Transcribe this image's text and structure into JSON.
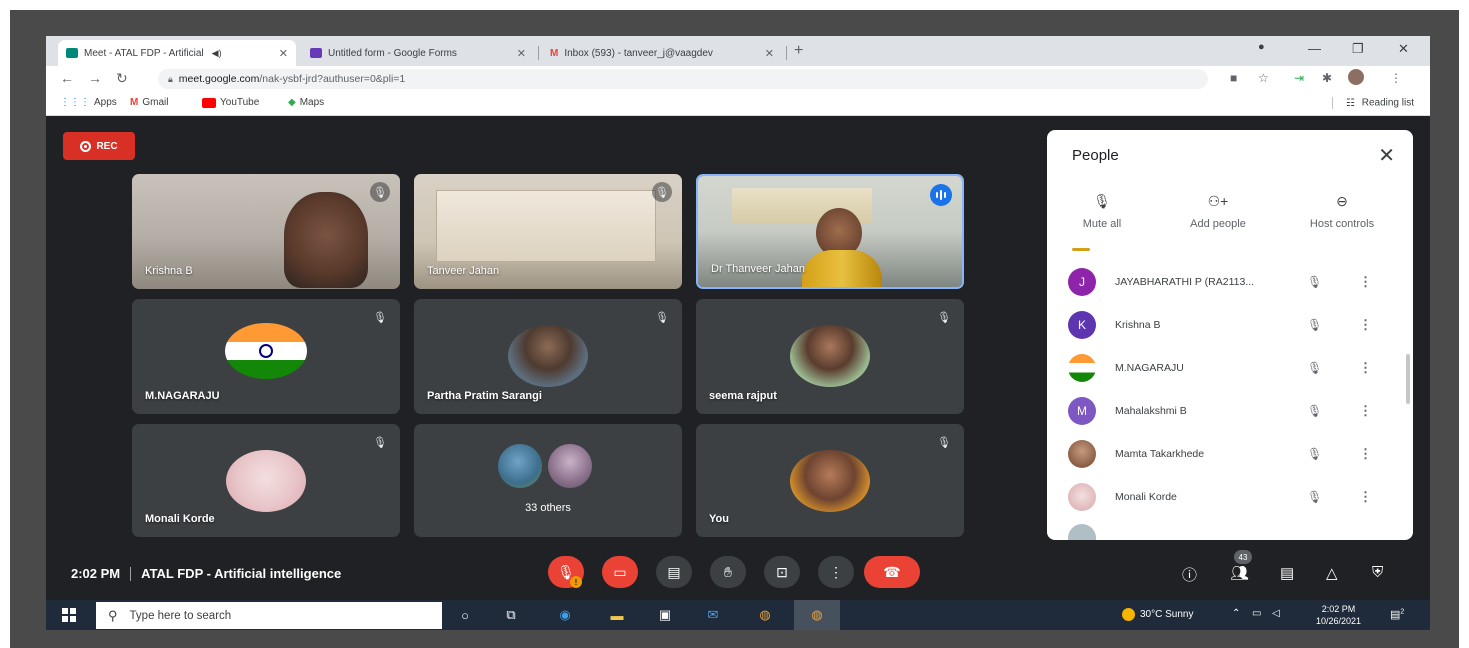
{
  "browser": {
    "tabs": [
      {
        "title": "Meet - ATAL FDP - Artificial",
        "audio_icon": "speaker-icon",
        "close": "✕",
        "active": true
      },
      {
        "title": "Untitled form - Google Forms",
        "close": "✕",
        "active": false
      },
      {
        "title": "Inbox (593) - tanveer_j@vaagdev",
        "close": "✕",
        "active": false
      }
    ],
    "new_tab": "+",
    "url_host": "meet.google.com",
    "url_path": "/nak-ysbf-jrd?authuser=0&pli=1",
    "bookmarks": [
      {
        "label": "Apps"
      },
      {
        "label": "Gmail"
      },
      {
        "label": "YouTube"
      },
      {
        "label": "Maps"
      }
    ],
    "reading_list": "Reading list"
  },
  "meet": {
    "rec_label": "REC",
    "tiles": [
      {
        "name": "Krishna B",
        "muted": true,
        "type": "video"
      },
      {
        "name": "Tanveer Jahan",
        "muted": true,
        "type": "video"
      },
      {
        "name": "Dr Thanveer Jahan",
        "muted": false,
        "speaking": true,
        "type": "video"
      },
      {
        "name": "M.NAGARAJU",
        "muted": true,
        "type": "avatar"
      },
      {
        "name": "Partha Pratim Sarangi",
        "muted": true,
        "type": "avatar"
      },
      {
        "name": "seema rajput",
        "muted": true,
        "type": "avatar"
      },
      {
        "name": "Monali Korde",
        "muted": true,
        "type": "avatar"
      },
      {
        "name": "33 others",
        "type": "group"
      },
      {
        "name": "You",
        "muted": true,
        "type": "avatar"
      }
    ],
    "time": "2:02 PM",
    "meeting_title": "ATAL FDP - Artificial intelligence",
    "participant_count": "43"
  },
  "people_panel": {
    "title": "People",
    "actions": [
      {
        "label": "Mute all",
        "icon": "mute-all-icon"
      },
      {
        "label": "Add people",
        "icon": "add-person-icon"
      },
      {
        "label": "Host controls",
        "icon": "host-controls-icon"
      }
    ],
    "participants": [
      {
        "name": "JAYABHARATHI P (RA2113...",
        "initial": "J",
        "color": "#8e24aa"
      },
      {
        "name": "Krishna B",
        "initial": "K",
        "color": "#5e35b1"
      },
      {
        "name": "M.NAGARAJU",
        "initial": "",
        "color": "#ffffff"
      },
      {
        "name": "Mahalakshmi B",
        "initial": "M",
        "color": "#7e57c2"
      },
      {
        "name": "Mamta Takarkhede",
        "initial": "",
        "color": "#b08a6e"
      },
      {
        "name": "Monali Korde",
        "initial": "",
        "color": "#e8c9c9"
      }
    ]
  },
  "taskbar": {
    "search_placeholder": "Type here to search",
    "weather": "30°C  Sunny",
    "clock_time": "2:02 PM",
    "clock_date": "10/26/2021",
    "notif_count": "2"
  }
}
